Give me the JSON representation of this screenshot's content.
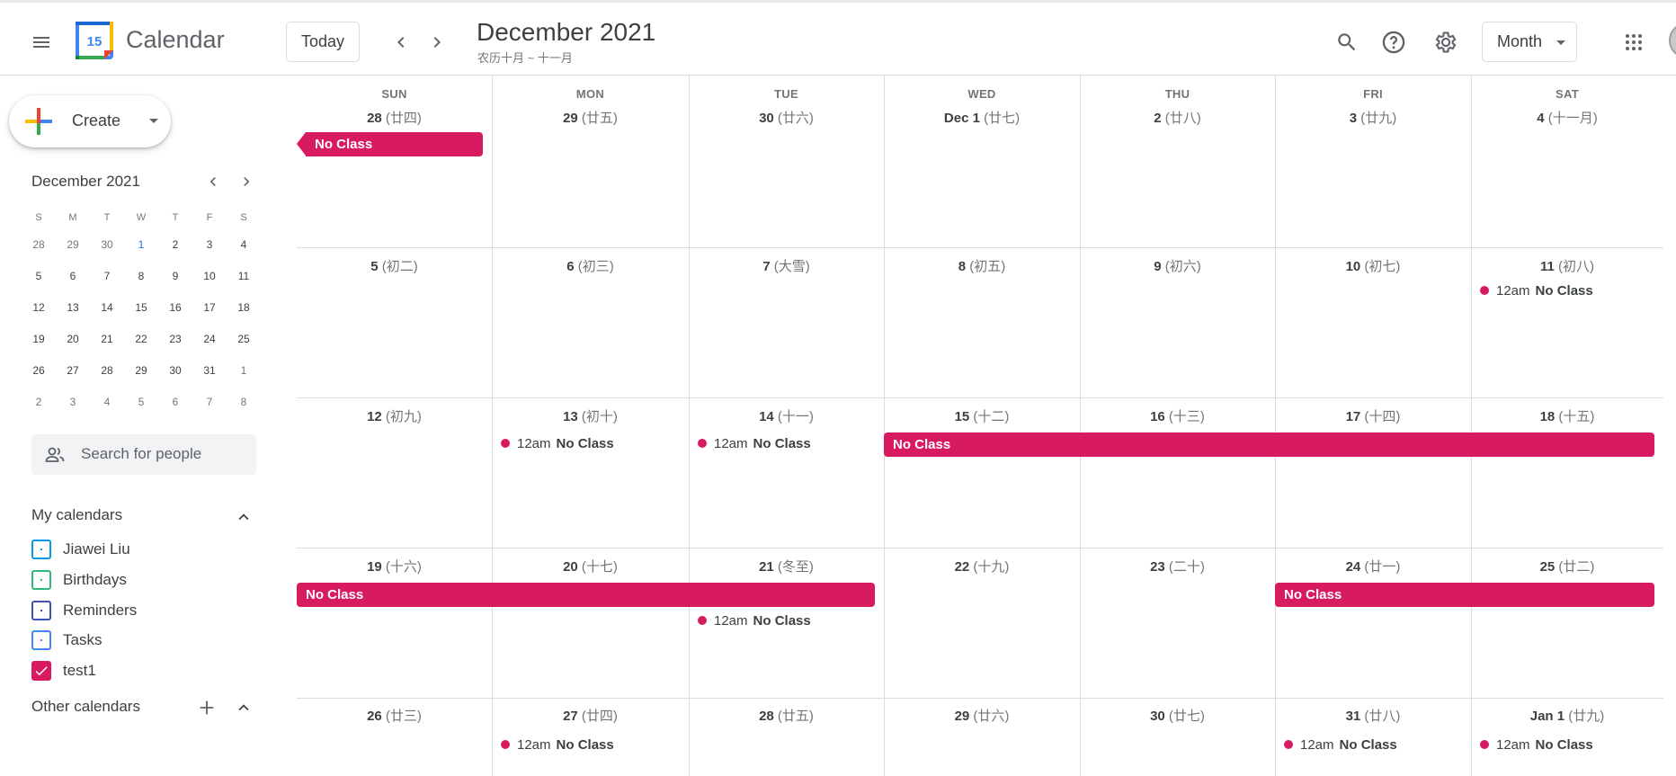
{
  "header": {
    "app_title": "Calendar",
    "logo_day": "15",
    "today_label": "Today",
    "month_title": "December 2021",
    "lunar_title": "农历十月 ~ 十一月",
    "view_label": "Month"
  },
  "sidebar": {
    "create_label": "Create",
    "mini_title": "December 2021",
    "mini_weekdays": [
      "S",
      "M",
      "T",
      "W",
      "T",
      "F",
      "S"
    ],
    "mini_weeks": [
      [
        "28",
        "29",
        "30",
        "1",
        "2",
        "3",
        "4"
      ],
      [
        "5",
        "6",
        "7",
        "8",
        "9",
        "10",
        "11"
      ],
      [
        "12",
        "13",
        "14",
        "15",
        "16",
        "17",
        "18"
      ],
      [
        "19",
        "20",
        "21",
        "22",
        "23",
        "24",
        "25"
      ],
      [
        "26",
        "27",
        "28",
        "29",
        "30",
        "31",
        "1"
      ],
      [
        "2",
        "3",
        "4",
        "5",
        "6",
        "7",
        "8"
      ]
    ],
    "search_placeholder": "Search for people",
    "my_calendars_title": "My calendars",
    "my_calendars": [
      {
        "label": "Jiawei Liu",
        "color": "#039be5",
        "checked": false
      },
      {
        "label": "Birthdays",
        "color": "#33b679",
        "checked": false
      },
      {
        "label": "Reminders",
        "color": "#3f51b5",
        "checked": false
      },
      {
        "label": "Tasks",
        "color": "#4285f4",
        "checked": false
      },
      {
        "label": "test1",
        "color": "#d81b60",
        "checked": true
      }
    ],
    "other_calendars_title": "Other calendars"
  },
  "grid": {
    "weekdays": [
      "SUN",
      "MON",
      "TUE",
      "WED",
      "THU",
      "FRI",
      "SAT"
    ],
    "event_color": "#d81b60",
    "weeks": [
      [
        {
          "day": "28",
          "lunar": "(廿四)"
        },
        {
          "day": "29",
          "lunar": "(廿五)"
        },
        {
          "day": "30",
          "lunar": "(廿六)"
        },
        {
          "day": "Dec 1",
          "lunar": "(廿七)",
          "bold": true
        },
        {
          "day": "2",
          "lunar": "(廿八)"
        },
        {
          "day": "3",
          "lunar": "(廿九)"
        },
        {
          "day": "4",
          "lunar": "(十一月)"
        }
      ],
      [
        {
          "day": "5",
          "lunar": "(初二)"
        },
        {
          "day": "6",
          "lunar": "(初三)"
        },
        {
          "day": "7",
          "lunar": "(大雪)"
        },
        {
          "day": "8",
          "lunar": "(初五)"
        },
        {
          "day": "9",
          "lunar": "(初六)"
        },
        {
          "day": "10",
          "lunar": "(初七)"
        },
        {
          "day": "11",
          "lunar": "(初八)"
        }
      ],
      [
        {
          "day": "12",
          "lunar": "(初九)"
        },
        {
          "day": "13",
          "lunar": "(初十)"
        },
        {
          "day": "14",
          "lunar": "(十一)"
        },
        {
          "day": "15",
          "lunar": "(十二)"
        },
        {
          "day": "16",
          "lunar": "(十三)"
        },
        {
          "day": "17",
          "lunar": "(十四)"
        },
        {
          "day": "18",
          "lunar": "(十五)"
        }
      ],
      [
        {
          "day": "19",
          "lunar": "(十六)"
        },
        {
          "day": "20",
          "lunar": "(十七)"
        },
        {
          "day": "21",
          "lunar": "(冬至)"
        },
        {
          "day": "22",
          "lunar": "(十九)"
        },
        {
          "day": "23",
          "lunar": "(二十)"
        },
        {
          "day": "24",
          "lunar": "(廿一)"
        },
        {
          "day": "25",
          "lunar": "(廿二)"
        }
      ],
      [
        {
          "day": "26",
          "lunar": "(廿三)"
        },
        {
          "day": "27",
          "lunar": "(廿四)"
        },
        {
          "day": "28",
          "lunar": "(廿五)"
        },
        {
          "day": "29",
          "lunar": "(廿六)"
        },
        {
          "day": "30",
          "lunar": "(廿七)"
        },
        {
          "day": "31",
          "lunar": "(廿八)"
        },
        {
          "day": "Jan 1",
          "lunar": "(廿九)"
        }
      ]
    ],
    "allday_events": [
      {
        "title": "No Class",
        "week": 0,
        "start": 0,
        "span": 1,
        "continues_before": true
      },
      {
        "title": "No Class",
        "week": 2,
        "start": 3,
        "span": 4,
        "continues_before": false
      },
      {
        "title": "No Class",
        "week": 3,
        "start": 0,
        "span": 3,
        "continues_before": false
      },
      {
        "title": "No Class",
        "week": 3,
        "start": 5,
        "span": 2,
        "continues_before": false
      }
    ],
    "timed_events": [
      {
        "time": "12am",
        "title": "No Class",
        "week": 1,
        "day": 6,
        "slot": 0
      },
      {
        "time": "12am",
        "title": "No Class",
        "week": 2,
        "day": 1,
        "slot": 0
      },
      {
        "time": "12am",
        "title": "No Class",
        "week": 2,
        "day": 2,
        "slot": 0
      },
      {
        "time": "12am",
        "title": "No Class",
        "week": 3,
        "day": 2,
        "slot": 1
      },
      {
        "time": "12am",
        "title": "No Class",
        "week": 4,
        "day": 1,
        "slot": 0
      },
      {
        "time": "12am",
        "title": "No Class",
        "week": 4,
        "day": 5,
        "slot": 0
      },
      {
        "time": "12am",
        "title": "No Class",
        "week": 4,
        "day": 6,
        "slot": 0
      }
    ]
  }
}
